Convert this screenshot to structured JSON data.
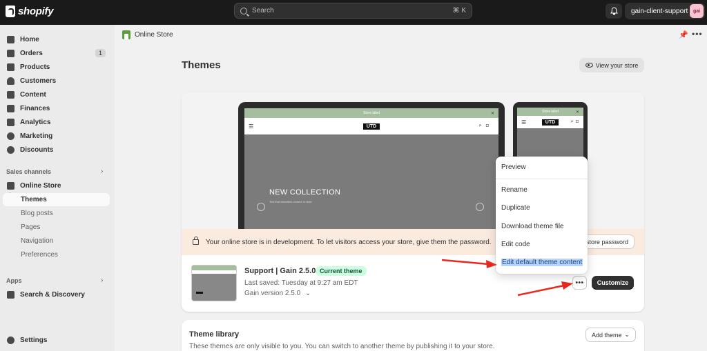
{
  "topbar": {
    "logo_text": "shopify",
    "search_placeholder": "Search",
    "search_shortcut": "⌘ K",
    "account_name": "gain-client-support",
    "account_initials": "gai"
  },
  "sidebar": {
    "items": [
      {
        "label": "Home",
        "icon": "home-icon"
      },
      {
        "label": "Orders",
        "icon": "orders-icon",
        "badge": "1"
      },
      {
        "label": "Products",
        "icon": "tag-icon"
      },
      {
        "label": "Customers",
        "icon": "person-icon"
      },
      {
        "label": "Content",
        "icon": "content-icon"
      },
      {
        "label": "Finances",
        "icon": "bank-icon"
      },
      {
        "label": "Analytics",
        "icon": "chart-icon"
      },
      {
        "label": "Marketing",
        "icon": "target-icon"
      },
      {
        "label": "Discounts",
        "icon": "discount-icon"
      }
    ],
    "sales_channels_label": "Sales channels",
    "online_store_label": "Online Store",
    "sub_items": [
      "Themes",
      "Blog posts",
      "Pages",
      "Navigation",
      "Preferences"
    ],
    "apps_label": "Apps",
    "search_discovery_label": "Search & Discovery",
    "settings_label": "Settings"
  },
  "breadcrumb": {
    "label": "Online Store"
  },
  "page": {
    "title": "Themes",
    "view_store_label": "View your store"
  },
  "preview": {
    "brand": "UTD",
    "hero_title": "NEW COLLECTION",
    "hero_sub": "Text that describes content or slide",
    "announcement": "Store label"
  },
  "banner": {
    "text": "Your online store is in development. To let visitors access your store, give them the password.",
    "button_label": "store password"
  },
  "theme": {
    "name": "Support | Gain 2.5.0",
    "badge": "Current theme",
    "last_saved": "Last saved: Tuesday at 9:27 am EDT",
    "version": "Gain version 2.5.0",
    "customize_label": "Customize",
    "more_label": "•••"
  },
  "menu": {
    "items": [
      "Preview",
      "Rename",
      "Duplicate",
      "Download theme file",
      "Edit code",
      "Edit default theme content"
    ]
  },
  "library": {
    "title": "Theme library",
    "description": "These themes are only visible to you. You can switch to another theme by publishing it to your store.",
    "add_label": "Add theme"
  },
  "colors": {
    "topbar": "#1a1a1a",
    "highlight": "#b3d4fd",
    "arrow": "#e8281f",
    "badge_bg": "#cdfee1"
  }
}
